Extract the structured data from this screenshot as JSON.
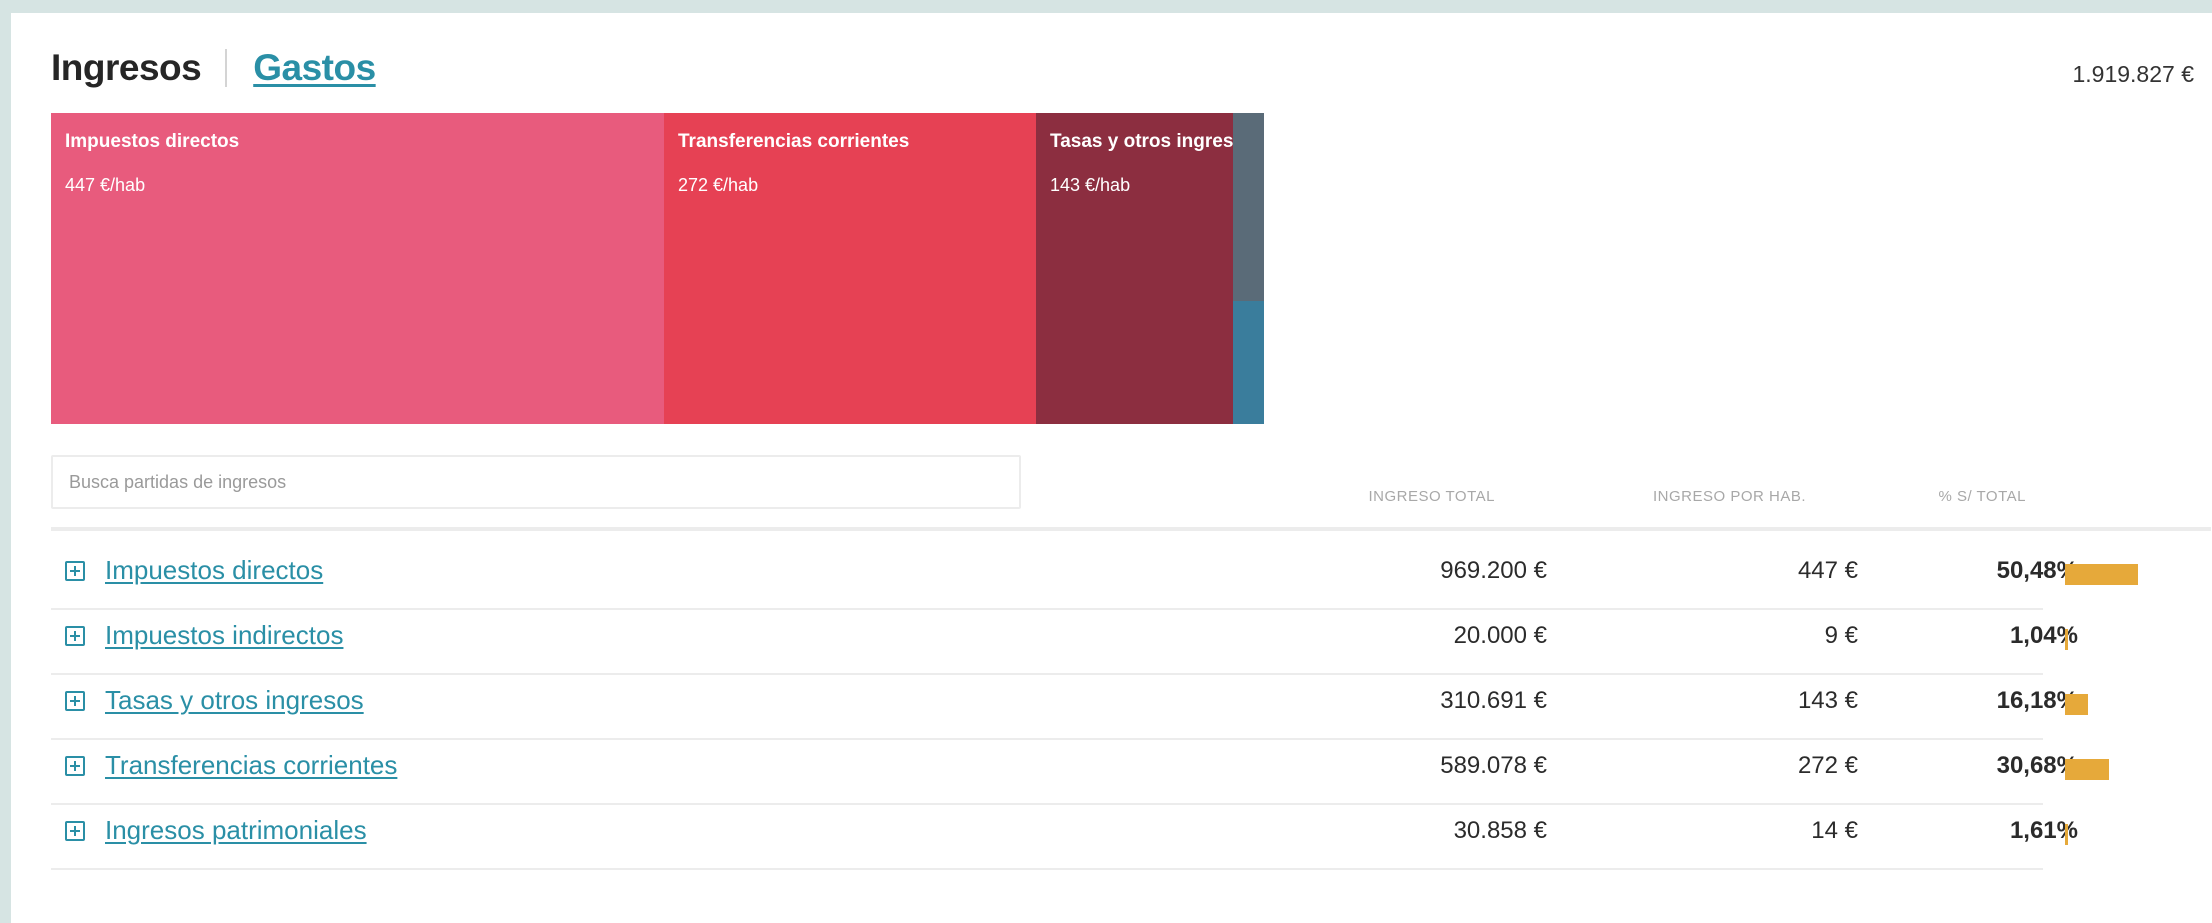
{
  "tabs": {
    "ingresos": "Ingresos",
    "gastos": "Gastos"
  },
  "grand_total": "1.919.827 €",
  "treemap": [
    {
      "name": "Impuestos directos",
      "per_hab": "447 €/hab",
      "color": "#e85b7d",
      "share": 0.5048
    },
    {
      "name": "Transferencias corrientes",
      "per_hab": "272 €/hab",
      "color": "#e64154",
      "share": 0.3068
    },
    {
      "name": "Tasas y otros ingresos",
      "per_hab": "143 €/hab",
      "color": "#8c2e40",
      "share": 0.1618
    },
    {
      "name": "",
      "per_hab": "",
      "color": "#5a6b78",
      "share": 0.0161
    },
    {
      "name": "",
      "per_hab": "",
      "color": "#3a7d9c",
      "share": 0.0104
    }
  ],
  "search": {
    "placeholder": "Busca partidas de ingresos"
  },
  "table": {
    "headers": {
      "total": "INGRESO TOTAL",
      "per_hab": "INGRESO POR HAB.",
      "pct": "% S/ TOTAL"
    },
    "rows": [
      {
        "label": "Impuestos directos",
        "total": "969.200 €",
        "per_hab": "447 €",
        "pct": "50,48%",
        "pct_value": 50.48
      },
      {
        "label": "Impuestos indirectos",
        "total": "20.000 €",
        "per_hab": "9 €",
        "pct": "1,04%",
        "pct_value": 1.04
      },
      {
        "label": "Tasas y otros ingresos",
        "total": "310.691 €",
        "per_hab": "143 €",
        "pct": "16,18%",
        "pct_value": 16.18
      },
      {
        "label": "Transferencias corrientes",
        "total": "589.078 €",
        "per_hab": "272 €",
        "pct": "30,68%",
        "pct_value": 30.68
      },
      {
        "label": "Ingresos patrimoniales",
        "total": "30.858 €",
        "per_hab": "14 €",
        "pct": "1,61%",
        "pct_value": 1.61
      }
    ]
  },
  "colors": {
    "accent": "#2a8fa6",
    "bar": "#e6a93a"
  }
}
